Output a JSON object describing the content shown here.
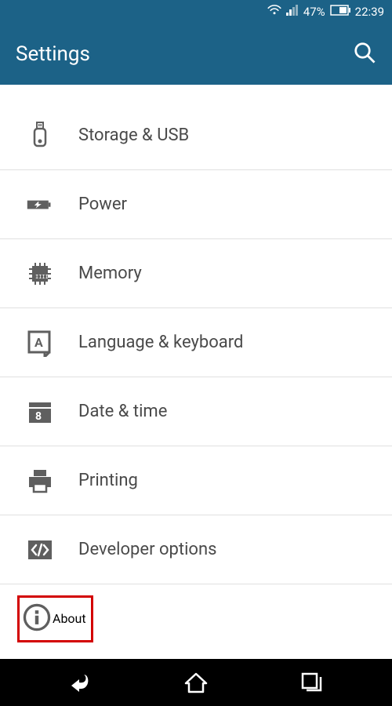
{
  "status": {
    "battery_pct": "47%",
    "time": "22:39"
  },
  "header": {
    "title": "Settings"
  },
  "items": [
    {
      "id": "storage",
      "label": "Storage & USB"
    },
    {
      "id": "power",
      "label": "Power"
    },
    {
      "id": "memory",
      "label": "Memory"
    },
    {
      "id": "language",
      "label": "Language & keyboard"
    },
    {
      "id": "datetime",
      "label": "Date & time"
    },
    {
      "id": "printing",
      "label": "Printing"
    },
    {
      "id": "devopts",
      "label": "Developer options"
    },
    {
      "id": "about",
      "label": "About"
    }
  ]
}
